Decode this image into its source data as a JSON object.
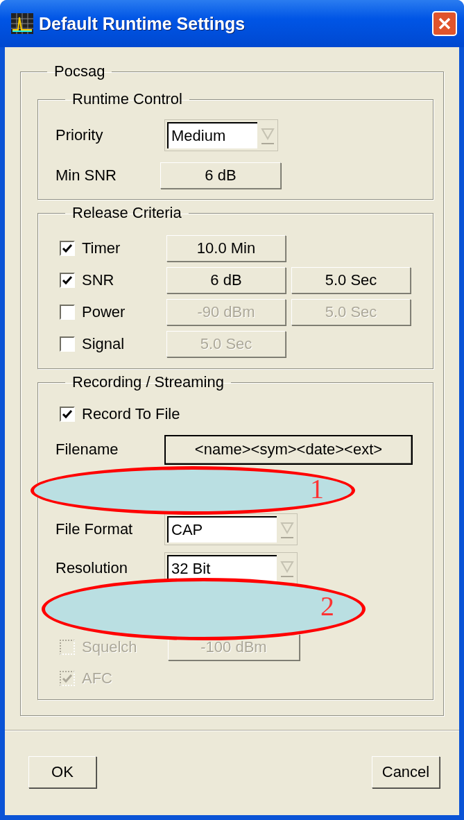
{
  "window": {
    "title": "Default Runtime Settings"
  },
  "group": {
    "title": "Pocsag",
    "runtime_control": {
      "title": "Runtime Control",
      "priority": {
        "label": "Priority",
        "value": "Medium"
      },
      "min_snr": {
        "label": "Min SNR",
        "value": "6 dB"
      }
    },
    "release_criteria": {
      "title": "Release Criteria",
      "rows": [
        {
          "label": "Timer",
          "checked": true,
          "values": [
            {
              "text": "10.0 Min",
              "disabled": false
            }
          ]
        },
        {
          "label": "SNR",
          "checked": true,
          "values": [
            {
              "text": "6 dB",
              "disabled": false
            },
            {
              "text": "5.0 Sec",
              "disabled": false
            }
          ]
        },
        {
          "label": "Power",
          "checked": false,
          "values": [
            {
              "text": "-90 dBm",
              "disabled": true
            },
            {
              "text": "5.0 Sec",
              "disabled": true
            }
          ]
        },
        {
          "label": "Signal",
          "checked": false,
          "values": [
            {
              "text": "5.0 Sec",
              "disabled": true
            }
          ]
        }
      ]
    },
    "recording": {
      "title": "Recording / Streaming",
      "record_to_file": {
        "label": "Record To File",
        "checked": true
      },
      "filename": {
        "label": "Filename",
        "value": "<name><sym><date><ext>"
      },
      "file_format": {
        "label": "File Format",
        "value": "CAP"
      },
      "resolution": {
        "label": "Resolution",
        "value": "32 Bit"
      },
      "squelch": {
        "label": "Squelch",
        "checked": false,
        "disabled": true,
        "value": "-100 dBm"
      },
      "afc": {
        "label": "AFC",
        "checked": true,
        "disabled": true
      }
    }
  },
  "annotations": [
    {
      "label": "1"
    },
    {
      "label": "2"
    }
  ],
  "buttons": [
    {
      "label": "OK"
    },
    {
      "label": "Cancel"
    }
  ]
}
